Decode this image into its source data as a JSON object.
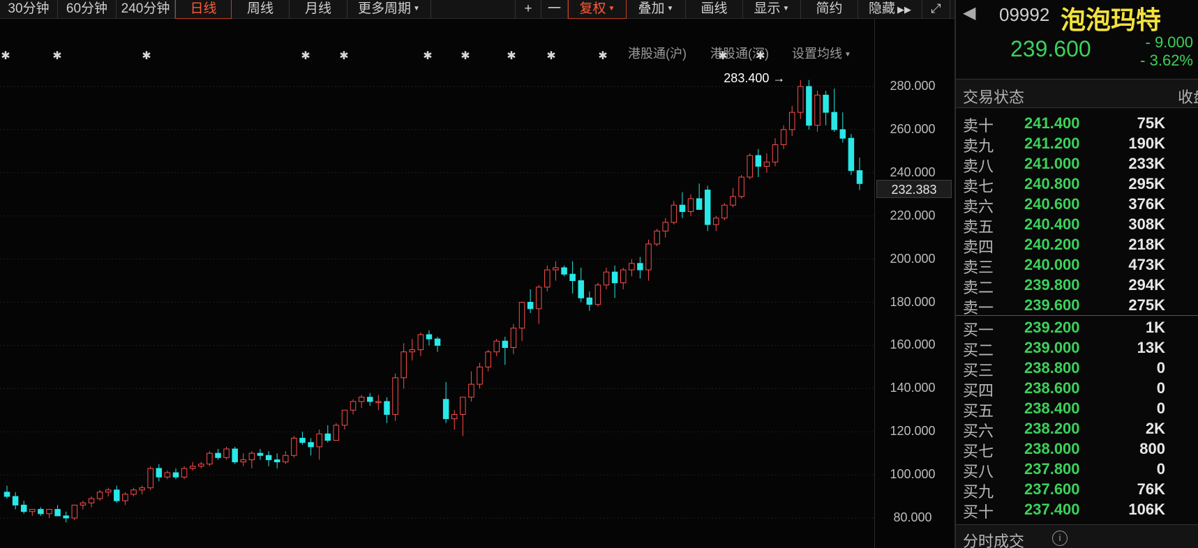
{
  "toolbar": {
    "periods": [
      "30分钟",
      "60分钟",
      "240分钟",
      "日线",
      "周线",
      "月线",
      "更多周期"
    ],
    "active_period": "日线",
    "tools": [
      "+",
      "一",
      "复权",
      "叠加",
      "画线",
      "显示",
      "简约",
      "隐藏"
    ],
    "active_tool": "复权"
  },
  "chart": {
    "sub_links": [
      "港股通(沪)",
      "港股通(深)",
      "设置均线"
    ],
    "price_axis": [
      "280.000",
      "260.000",
      "240.000",
      "220.000",
      "200.000",
      "180.000",
      "160.000",
      "140.000",
      "120.000",
      "100.000",
      "80.000"
    ],
    "current_price_label": "232.383",
    "max_label": "283.400",
    "up_color": "#ff4d4d",
    "down_color": "#29e8e8",
    "candles": [
      [
        92,
        95,
        89,
        90
      ],
      [
        90,
        92,
        84,
        86
      ],
      [
        86,
        88,
        82,
        83
      ],
      [
        83,
        84,
        81,
        84
      ],
      [
        84,
        85,
        81,
        82
      ],
      [
        82,
        84,
        80,
        84
      ],
      [
        84,
        86,
        81,
        81
      ],
      [
        81,
        83,
        78,
        80
      ],
      [
        80,
        86,
        79,
        86
      ],
      [
        86,
        88,
        84,
        87
      ],
      [
        87,
        90,
        85,
        89
      ],
      [
        89,
        93,
        88,
        92
      ],
      [
        92,
        94,
        90,
        93
      ],
      [
        93,
        95,
        87,
        88
      ],
      [
        88,
        92,
        86,
        91
      ],
      [
        91,
        94,
        90,
        93
      ],
      [
        93,
        95,
        91,
        94
      ],
      [
        94,
        104,
        93,
        103
      ],
      [
        103,
        105,
        97,
        99
      ],
      [
        99,
        102,
        98,
        101
      ],
      [
        101,
        103,
        98,
        99
      ],
      [
        99,
        104,
        98,
        103
      ],
      [
        103,
        106,
        102,
        104
      ],
      [
        104,
        106,
        103,
        105
      ],
      [
        105,
        111,
        104,
        110
      ],
      [
        110,
        112,
        107,
        108
      ],
      [
        108,
        113,
        107,
        112
      ],
      [
        112,
        113,
        105,
        106
      ],
      [
        106,
        110,
        104,
        107
      ],
      [
        107,
        111,
        103,
        110
      ],
      [
        110,
        112,
        107,
        109
      ],
      [
        109,
        111,
        104,
        107
      ],
      [
        107,
        110,
        103,
        106
      ],
      [
        106,
        111,
        105,
        109
      ],
      [
        109,
        118,
        108,
        117
      ],
      [
        117,
        120,
        114,
        115
      ],
      [
        115,
        117,
        109,
        113
      ],
      [
        113,
        121,
        107,
        119
      ],
      [
        119,
        123,
        115,
        116
      ],
      [
        116,
        124,
        116,
        123
      ],
      [
        123,
        130,
        121,
        130
      ],
      [
        130,
        135,
        128,
        134
      ],
      [
        134,
        137,
        131,
        136
      ],
      [
        136,
        138,
        132,
        134
      ],
      [
        134,
        137,
        130,
        134
      ],
      [
        134,
        136,
        124,
        128
      ],
      [
        128,
        147,
        125,
        145
      ],
      [
        145,
        161,
        140,
        157
      ],
      [
        157,
        163,
        153,
        158
      ],
      [
        158,
        166,
        155,
        165
      ],
      [
        165,
        167,
        160,
        163
      ],
      [
        163,
        164,
        157,
        160
      ],
      [
        135,
        143,
        124,
        126
      ],
      [
        126,
        130,
        121,
        128
      ],
      [
        128,
        136,
        118,
        136
      ],
      [
        136,
        148,
        134,
        142
      ],
      [
        142,
        152,
        140,
        150
      ],
      [
        150,
        158,
        148,
        157
      ],
      [
        157,
        163,
        155,
        162
      ],
      [
        162,
        164,
        151,
        159
      ],
      [
        159,
        170,
        156,
        168
      ],
      [
        168,
        178,
        162,
        180
      ],
      [
        180,
        186,
        175,
        177
      ],
      [
        177,
        188,
        170,
        187
      ],
      [
        187,
        197,
        185,
        195
      ],
      [
        195,
        199,
        190,
        196
      ],
      [
        196,
        197,
        192,
        193
      ],
      [
        193,
        199,
        184,
        190
      ],
      [
        190,
        196,
        180,
        182
      ],
      [
        182,
        185,
        176,
        179
      ],
      [
        179,
        189,
        178,
        188
      ],
      [
        188,
        196,
        186,
        194
      ],
      [
        194,
        197,
        182,
        189
      ],
      [
        189,
        196,
        186,
        195
      ],
      [
        195,
        200,
        192,
        198
      ],
      [
        198,
        201,
        191,
        195
      ],
      [
        195,
        209,
        190,
        207
      ],
      [
        207,
        214,
        206,
        213
      ],
      [
        213,
        219,
        210,
        217
      ],
      [
        217,
        227,
        216,
        225
      ],
      [
        225,
        231,
        219,
        222
      ],
      [
        222,
        230,
        220,
        228
      ],
      [
        228,
        235,
        224,
        223
      ],
      [
        232,
        234,
        213,
        216
      ],
      [
        216,
        220,
        213,
        219
      ],
      [
        219,
        226,
        218,
        225
      ],
      [
        225,
        233,
        224,
        229
      ],
      [
        229,
        239,
        228,
        238
      ],
      [
        238,
        249,
        237,
        248
      ],
      [
        248,
        251,
        238,
        243
      ],
      [
        243,
        249,
        240,
        245
      ],
      [
        245,
        256,
        243,
        253
      ],
      [
        253,
        262,
        251,
        260
      ],
      [
        260,
        271,
        257,
        268
      ],
      [
        268,
        283,
        265,
        280
      ],
      [
        280,
        283,
        260,
        262
      ],
      [
        262,
        278,
        259,
        276
      ],
      [
        276,
        278,
        262,
        268
      ],
      [
        268,
        279,
        259,
        260
      ],
      [
        260,
        268,
        254,
        256
      ],
      [
        256,
        258,
        239,
        241
      ],
      [
        241,
        247,
        232,
        235
      ]
    ]
  },
  "panel": {
    "code": "09992",
    "name": "泡泡玛特",
    "last_price": "239.600",
    "change": "- 9.000",
    "change_pct": "- 3.62%",
    "state_label": "交易状态",
    "state_value": "收盘",
    "asks": [
      {
        "label": "卖十",
        "price": "241.400",
        "vol": "75K"
      },
      {
        "label": "卖九",
        "price": "241.200",
        "vol": "190K"
      },
      {
        "label": "卖八",
        "price": "241.000",
        "vol": "233K"
      },
      {
        "label": "卖七",
        "price": "240.800",
        "vol": "295K"
      },
      {
        "label": "卖六",
        "price": "240.600",
        "vol": "376K"
      },
      {
        "label": "卖五",
        "price": "240.400",
        "vol": "308K"
      },
      {
        "label": "卖四",
        "price": "240.200",
        "vol": "218K"
      },
      {
        "label": "卖三",
        "price": "240.000",
        "vol": "473K"
      },
      {
        "label": "卖二",
        "price": "239.800",
        "vol": "294K"
      },
      {
        "label": "卖一",
        "price": "239.600",
        "vol": "275K"
      }
    ],
    "bids": [
      {
        "label": "买一",
        "price": "239.200",
        "vol": "1K"
      },
      {
        "label": "买二",
        "price": "239.000",
        "vol": "13K"
      },
      {
        "label": "买三",
        "price": "238.800",
        "vol": "0"
      },
      {
        "label": "买四",
        "price": "238.600",
        "vol": "0"
      },
      {
        "label": "买五",
        "price": "238.400",
        "vol": "0"
      },
      {
        "label": "买六",
        "price": "238.200",
        "vol": "2K"
      },
      {
        "label": "买七",
        "price": "238.000",
        "vol": "800"
      },
      {
        "label": "买八",
        "price": "237.800",
        "vol": "0"
      },
      {
        "label": "买九",
        "price": "237.600",
        "vol": "76K"
      },
      {
        "label": "买十",
        "price": "237.400",
        "vol": "106K"
      }
    ],
    "bottom_label": "分时成交",
    "info_icon": "info-icon"
  }
}
